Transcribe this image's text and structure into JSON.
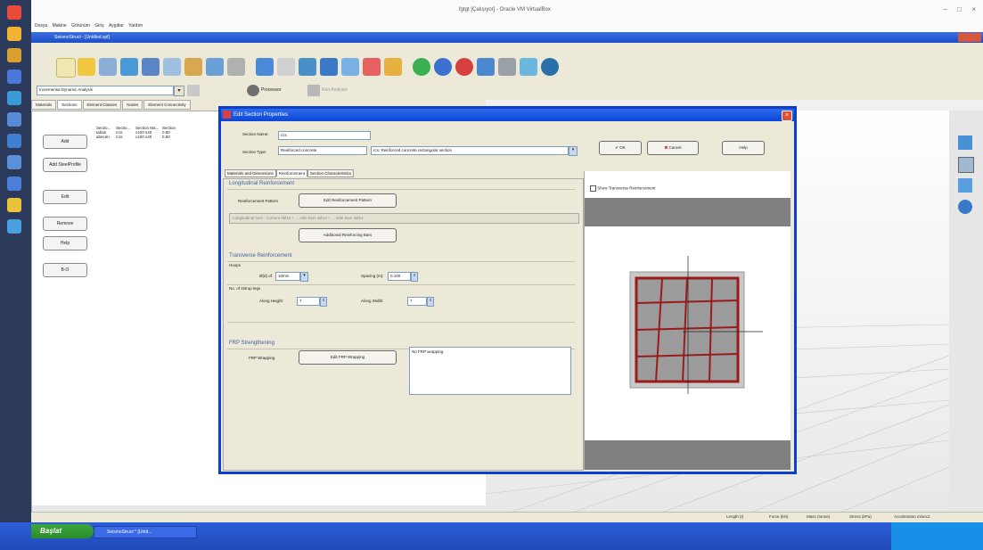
{
  "host": {
    "window_title": "fgtgt [Çalışıyor] - Oracle VM VirtualBox",
    "menu": [
      "Dosya",
      "Makine",
      "Görünüm",
      "Giriş",
      "Aygıtlar",
      "Yardım"
    ]
  },
  "app": {
    "title": "SeismoStruct - [Untitled.spf]",
    "analysis_type": "Incremental Dynamic Analysis",
    "toolbar2": {
      "processor_label": "Processor",
      "run_label": "Run Analysis"
    },
    "tabs": [
      "Materials",
      "Sections",
      "Element Classes",
      "Nodes",
      "Element Connectivity"
    ],
    "left_buttons": [
      "Add",
      "Add SteelProfile",
      "Edit",
      "Remove",
      "Help",
      "B-O"
    ],
    "sections_table": {
      "headers": [
        "Sectio...",
        "Sectio...",
        "Section Ma...",
        "Section"
      ],
      "rows": [
        [
          "taban",
          "rcrs",
          "c420  s40",
          "0.50"
        ],
        [
          "abecen",
          "rcrs",
          "c420  s40",
          "0.50"
        ]
      ]
    },
    "status": [
      "Length (t)",
      "Force (kN)",
      "Mass (tonne)",
      "Stress (kPa)",
      "Acceleration m/sec2"
    ]
  },
  "dialog": {
    "title": "Edit Section Properties",
    "section_name_label": "Section Name:",
    "section_name_value": "ccs",
    "section_type_label": "Section Type:",
    "section_type_value": "Reinforced concrete",
    "section_type_desc": "rcs: Reinforced concrete rectangular section",
    "ok_label": "OK",
    "cancel_label": "Cancel",
    "help_label": "Help",
    "tabs": [
      "Materials and Dimensions",
      "Reinforcement",
      "Section Characteristics"
    ],
    "longitudinal": {
      "heading": "Longitudinal Reinforcement",
      "pattern_label": "Reinforcement Pattern",
      "edit_pattern_btn": "Edit Reinforcement Pattern",
      "info": "Longitudinal bars :  corners 4Ø16 + ... side bars 4Ø14 + ... side bars 4Ø14",
      "additional_btn": "Additional Reinforcing Bars"
    },
    "transverse": {
      "heading": "Transverse Reinforcement",
      "hoops_label": "Hoops",
      "bar_label": "Ø(d) of",
      "bar_value": "10mm",
      "spacing_label": "Spacing (m):",
      "spacing_value": "0.100",
      "legs_label": "No. of stirrup legs",
      "height_label": "Along Height:",
      "height_value": "7",
      "width_label": "Along Width:",
      "width_value": "7"
    },
    "frp": {
      "heading": "FRP Strengthening",
      "wrapping_label": "FRP Wrapping",
      "edit_btn": "Edit FRP Wrapping",
      "note": "No FRP wrapping"
    },
    "preview": {
      "checkbox_label": "Show Transverse Reinforcement"
    }
  },
  "taskbar": {
    "start_label": "Başlat",
    "task_item": "SeismoStruct * [Untit..."
  },
  "colors": {
    "section_fill": "#9c9c9c",
    "rebar": "#9a1b1b",
    "dialog_border": "#0a3fd0"
  }
}
